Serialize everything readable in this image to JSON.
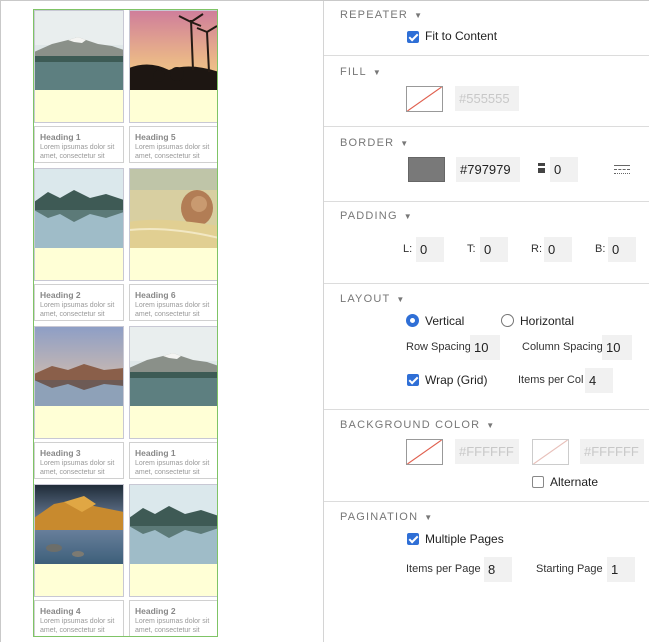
{
  "canvas": {
    "cells": [
      {
        "heading": "Heading 1",
        "body": "Lorem ipsumas dolor sit amet, consectetur sit",
        "scene": "mountain-lake"
      },
      {
        "heading": "Heading 5",
        "body": "Lorem ipsumas dolor sit amet, consectetur sit",
        "scene": "palm-sunset"
      },
      {
        "heading": "Heading 2",
        "body": "Lorem ipsumas dolor sit amet, consectetur sit",
        "scene": "lake-reflection"
      },
      {
        "heading": "Heading 6",
        "body": "Lorem ipsumas dolor sit amet, consectetur sit",
        "scene": "beach-rock"
      },
      {
        "heading": "Heading 3",
        "body": "Lorem ipsumas dolor sit amet, consectetur sit",
        "scene": "dusk-lake"
      },
      {
        "heading": "Heading 1",
        "body": "Lorem ipsumas dolor sit amet, consectetur sit",
        "scene": "mountain-lake"
      },
      {
        "heading": "Heading 4",
        "body": "Lorem ipsumas dolor sit amet, consectetur sit",
        "scene": "rocky-shore"
      },
      {
        "heading": "Heading 2",
        "body": "Lorem ipsumas dolor sit amet, consectetur sit",
        "scene": "lake-reflection"
      }
    ]
  },
  "panel": {
    "repeater": {
      "title": "REPEATER",
      "fit_label": "Fit to Content",
      "fit_checked": true
    },
    "fill": {
      "title": "FILL",
      "color_placeholder": "#555555"
    },
    "border": {
      "title": "BORDER",
      "color": "#797979",
      "width": "0"
    },
    "padding": {
      "title": "PADDING",
      "l_label": "L:",
      "l": "0",
      "t_label": "T:",
      "t": "0",
      "r_label": "R:",
      "r": "0",
      "b_label": "B:",
      "b": "0"
    },
    "layout": {
      "title": "LAYOUT",
      "vertical_label": "Vertical",
      "horizontal_label": "Horizontal",
      "orientation": "vertical",
      "row_spacing_label": "Row Spacing",
      "row_spacing": "10",
      "col_spacing_label": "Column Spacing",
      "col_spacing": "10",
      "wrap_label": "Wrap (Grid)",
      "wrap_checked": true,
      "items_per_col_label": "Items per Col",
      "items_per_col": "4"
    },
    "background": {
      "title": "BACKGROUND COLOR",
      "color1_placeholder": "#FFFFFF",
      "color2_placeholder": "#FFFFFF",
      "alternate_label": "Alternate",
      "alternate_checked": false
    },
    "pagination": {
      "title": "PAGINATION",
      "multiple_label": "Multiple Pages",
      "multiple_checked": true,
      "items_per_page_label": "Items per Page",
      "items_per_page": "8",
      "starting_page_label": "Starting Page",
      "starting_page": "1"
    }
  }
}
